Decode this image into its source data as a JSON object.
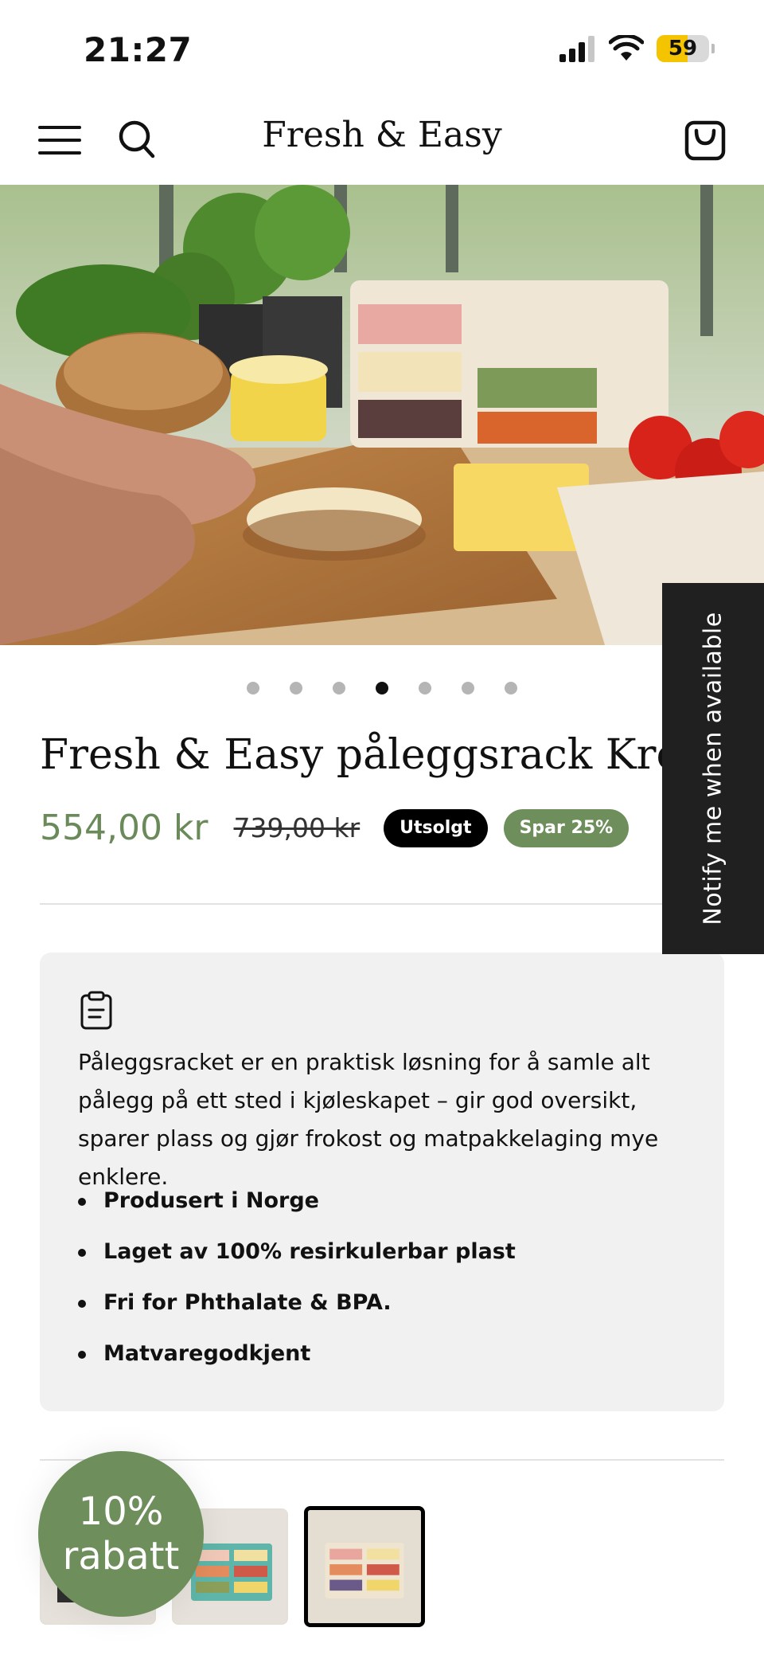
{
  "status_bar": {
    "time": "21:27",
    "battery_level": "59",
    "battery_fraction": 0.59,
    "icons": [
      "signal-icon",
      "wifi-icon",
      "battery-icon"
    ]
  },
  "header": {
    "brand": "Fresh & Easy",
    "icons": [
      "hamburger-menu-icon",
      "search-icon",
      "shopping-bag-icon"
    ]
  },
  "gallery": {
    "dot_count": 7,
    "active_index": 3
  },
  "product": {
    "title": "Fresh & Easy påleggsrack Kremhvit",
    "price": "554,00 kr",
    "compare_price": "739,00 kr",
    "badge_sold_out": "Utsolgt",
    "badge_save": "Spar 25%"
  },
  "info": {
    "icon": "clipboard-icon",
    "description": "Påleggsracket er en praktisk løsning for å samle alt pålegg på ett sted i kjøleskapet – gir god oversikt, sparer plass og gjør frokost og matpakkelaging mye enklere.",
    "bullets": [
      "Produsert i Norge",
      "Laget av 100% resirkulerbar plast",
      "Fri for Phthalate & BPA.",
      "Matvaregodkjent"
    ]
  },
  "discount_bubble": {
    "line1": "10%",
    "line2": "rabatt"
  },
  "notify": {
    "label": "Notify me when available"
  },
  "colors": {
    "accent_green": "#6e8e5c",
    "price_green": "#6b8a5a",
    "dark_tab": "#202020",
    "battery_yellow": "#f5c400"
  }
}
